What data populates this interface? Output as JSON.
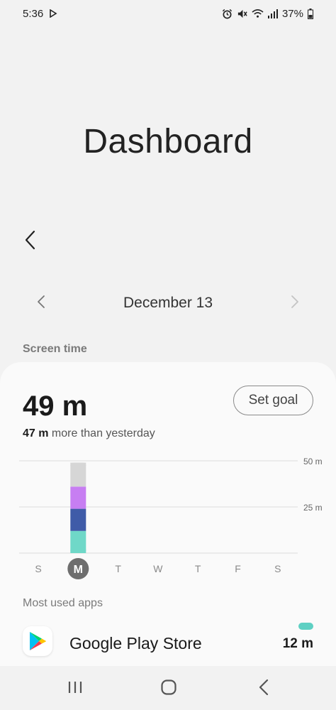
{
  "status_bar": {
    "time": "5:36",
    "battery": "37%",
    "icons_left": [
      "play-notification-icon"
    ],
    "icons_right": [
      "alarm-icon",
      "mute-icon",
      "wifi-icon",
      "signal-icon",
      "battery-icon"
    ]
  },
  "page": {
    "title": "Dashboard"
  },
  "date_nav": {
    "date": "December 13"
  },
  "screen_time": {
    "section_label": "Screen time",
    "total": "49 m",
    "comparison_value": "47 m",
    "comparison_text": "more than yesterday",
    "goal_button": "Set goal"
  },
  "chart_data": {
    "type": "bar",
    "categories": [
      "S",
      "M",
      "T",
      "W",
      "T",
      "F",
      "S"
    ],
    "selected_index": 1,
    "series": [
      {
        "values": [
          0,
          12,
          0,
          0,
          0,
          0,
          0
        ],
        "color": "#6fd8c8"
      },
      {
        "values": [
          0,
          12,
          0,
          0,
          0,
          0,
          0
        ],
        "color": "#3f5ba8"
      },
      {
        "values": [
          0,
          12,
          0,
          0,
          0,
          0,
          0
        ],
        "color": "#c77ef2"
      },
      {
        "values": [
          0,
          13,
          0,
          0,
          0,
          0,
          0
        ],
        "color": "#d6d6d6"
      }
    ],
    "y_ticks": [
      {
        "value": 25,
        "label": "25 m"
      },
      {
        "value": 50,
        "label": "50 m"
      }
    ],
    "ylim": [
      0,
      50
    ],
    "grid": true
  },
  "most_used": {
    "section_label": "Most used apps",
    "apps": [
      {
        "name": "Google Play Store",
        "time": "12 m",
        "bar_color": "#5ed0c3"
      }
    ]
  },
  "colors": {
    "background": "#f2f2f2",
    "card": "#fafafa",
    "accent_teal": "#5ed0c3",
    "selected_day": "#6e6e6e"
  },
  "nav_bar": {
    "icons": [
      "recents-icon",
      "home-icon",
      "back-nav-icon"
    ]
  }
}
